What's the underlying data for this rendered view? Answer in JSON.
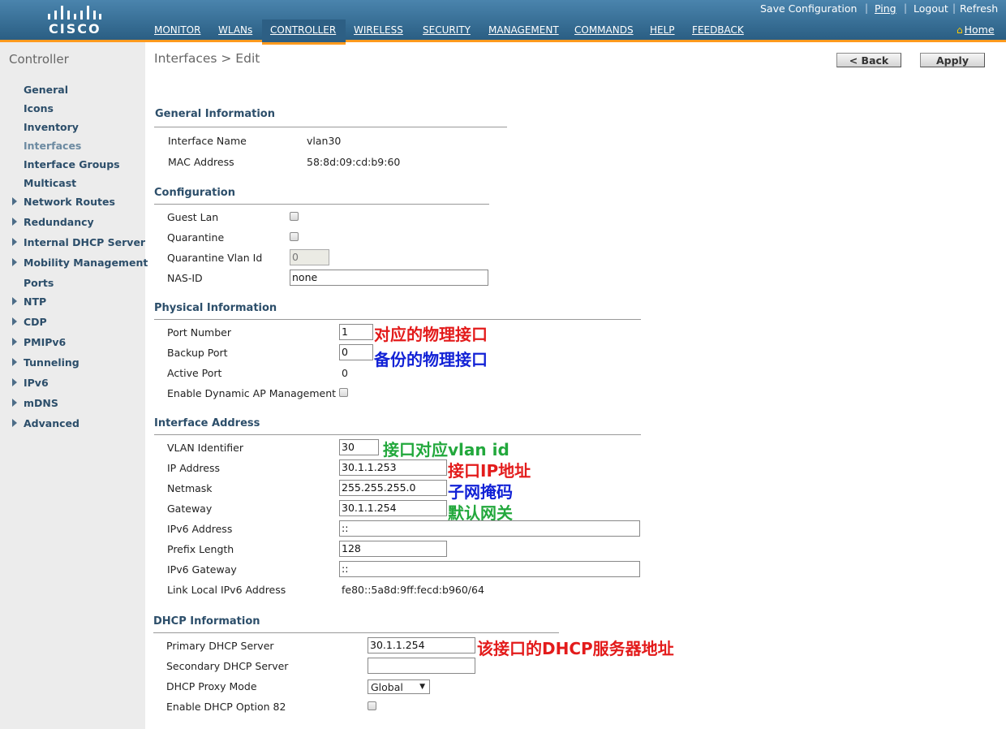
{
  "colors": {
    "header_top": "#4a84ad",
    "header_bottom": "#2a5e83",
    "accent": "#ff9a1e",
    "section": "#2c4e6a",
    "ann_red": "#e31b1b",
    "ann_blue": "#1222d6",
    "ann_green": "#22a83c"
  },
  "logo": {
    "text": "CISCO"
  },
  "nav": [
    "MONITOR",
    "WLANs",
    "CONTROLLER",
    "WIRELESS",
    "SECURITY",
    "MANAGEMENT",
    "COMMANDS",
    "HELP",
    "FEEDBACK"
  ],
  "nav_active": "CONTROLLER",
  "toplinks": {
    "save": "Save Configuration",
    "ping": "Ping",
    "logout": "Logout",
    "refresh": "Refresh",
    "home": "Home"
  },
  "sidebar": {
    "title": "Controller",
    "items": [
      "General",
      "Icons",
      "Inventory",
      "Interfaces",
      "Interface Groups",
      "Multicast",
      "Network Routes",
      "Redundancy",
      "Internal DHCP Server",
      "Mobility Management",
      "Ports",
      "NTP",
      "CDP",
      "PMIPv6",
      "Tunneling",
      "IPv6",
      "mDNS",
      "Advanced"
    ]
  },
  "breadcrumb": "Interfaces > Edit",
  "buttons": {
    "back": "< Back",
    "apply": "Apply"
  },
  "general": {
    "title": "General Information",
    "name_label": "Interface Name",
    "name_value": "vlan30",
    "mac_label": "MAC Address",
    "mac_value": "58:8d:09:cd:b9:60"
  },
  "config": {
    "title": "Configuration",
    "guest_lan": "Guest Lan",
    "quarantine": "Quarantine",
    "quarantine_vlan_label": "Quarantine Vlan Id",
    "quarantine_vlan_value": "0",
    "nas_label": "NAS-ID",
    "nas_value": "none"
  },
  "physical": {
    "title": "Physical Information",
    "port_label": "Port Number",
    "port_value": "1",
    "backup_label": "Backup Port",
    "backup_value": "0",
    "active_label": "Active Port",
    "active_value": "0",
    "dyn_ap_label": "Enable Dynamic AP Management"
  },
  "iface_addr": {
    "title": "Interface Address",
    "vlan_label": "VLAN Identifier",
    "vlan_value": "30",
    "ip_label": "IP Address",
    "ip_value": "30.1.1.253",
    "mask_label": "Netmask",
    "mask_value": "255.255.255.0",
    "gw_label": "Gateway",
    "gw_value": "30.1.1.254",
    "ipv6_label": "IPv6 Address",
    "ipv6_value": "::",
    "prefix_label": "Prefix Length",
    "prefix_value": "128",
    "ipv6gw_label": "IPv6 Gateway",
    "ipv6gw_value": "::",
    "ll_label": "Link Local IPv6 Address",
    "ll_value": "fe80::5a8d:9ff:fecd:b960/64"
  },
  "dhcp": {
    "title": "DHCP Information",
    "primary_label": "Primary DHCP Server",
    "primary_value": "30.1.1.254",
    "secondary_label": "Secondary DHCP Server",
    "secondary_value": "",
    "proxy_label": "DHCP Proxy Mode",
    "proxy_value": "Global",
    "opt82_label": "Enable DHCP Option 82"
  },
  "annotations": {
    "port": "对应的物理接口",
    "backup": "备份的物理接口",
    "vlan": "接口对应vlan id",
    "ip": "接口IP地址",
    "mask": "子网掩码",
    "gw": "默认网关",
    "dhcp": "该接口的DHCP服务器地址"
  }
}
